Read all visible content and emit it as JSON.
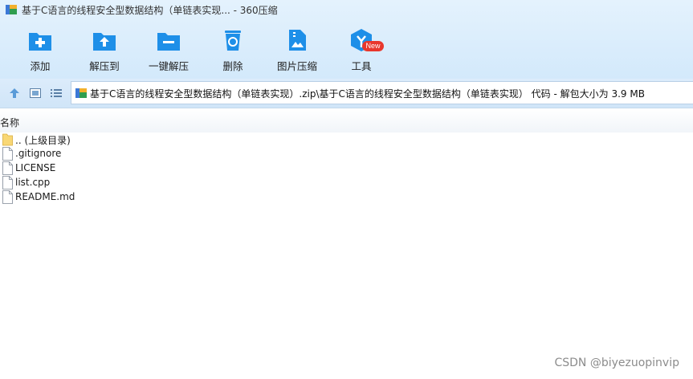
{
  "window": {
    "title": "基于C语言的线程安全型数据结构（单链表实现... - 360压缩"
  },
  "toolbar": {
    "items": [
      {
        "label": "添加",
        "icon": "add-folder-icon"
      },
      {
        "label": "解压到",
        "icon": "extract-to-folder-icon"
      },
      {
        "label": "一键解压",
        "icon": "one-click-extract-folder-icon"
      },
      {
        "label": "删除",
        "icon": "recycle-bin-icon"
      },
      {
        "label": "图片压缩",
        "icon": "image-compress-icon"
      },
      {
        "label": "工具",
        "icon": "tools-cube-icon"
      }
    ],
    "new_badge": "New"
  },
  "address": {
    "path": "基于C语言的线程安全型数据结构（单链表实现）.zip\\基于C语言的线程安全型数据结构（单链表实现） 代码 - 解包大小为 3.9 MB"
  },
  "file_list": {
    "column_name": "名称",
    "items": [
      {
        "name": ".. (上级目录)",
        "type": "folder"
      },
      {
        "name": ".gitignore",
        "type": "file"
      },
      {
        "name": "LICENSE",
        "type": "file"
      },
      {
        "name": "list.cpp",
        "type": "file"
      },
      {
        "name": "README.md",
        "type": "file"
      }
    ]
  },
  "watermark": "CSDN @biyezuopinvip",
  "colors": {
    "accent_blue": "#1e8fe8",
    "badge_red": "#e8372d",
    "header_bg": "#d8ecfc"
  }
}
